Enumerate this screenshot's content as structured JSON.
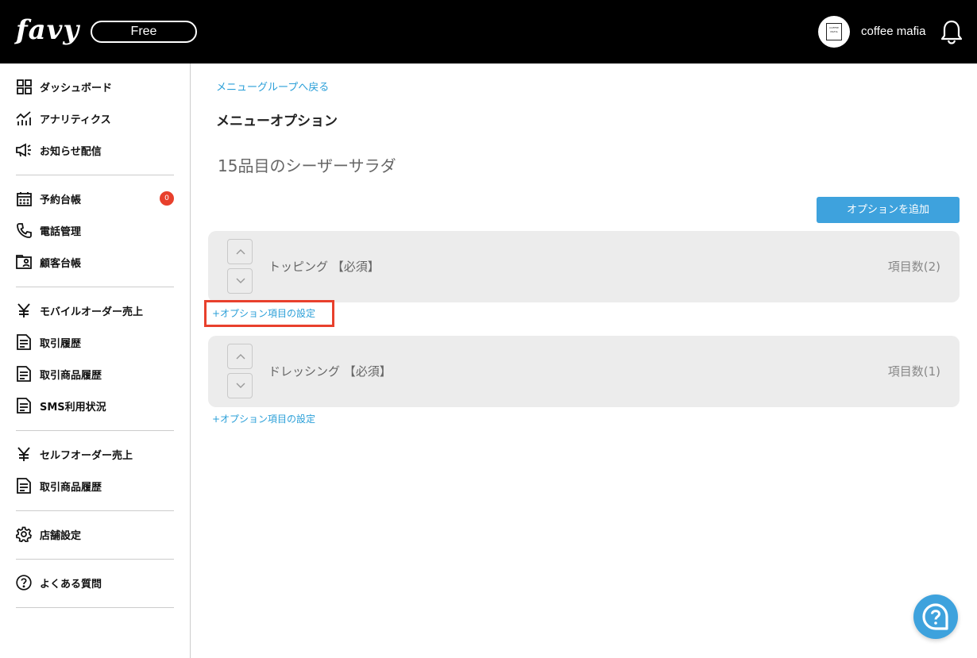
{
  "header": {
    "logo": "favy",
    "plan": "Free",
    "shop_name": "coffee mafia",
    "avatar_text": "COFFEE MAFIA"
  },
  "sidebar": {
    "items": [
      {
        "label": "ダッシュボード",
        "icon": "grid-icon"
      },
      {
        "label": "アナリティクス",
        "icon": "chart-icon"
      },
      {
        "label": "お知らせ配信",
        "icon": "megaphone-icon"
      },
      {
        "label": "予約台帳",
        "icon": "calendar-icon",
        "badge": "0"
      },
      {
        "label": "電話管理",
        "icon": "phone-icon"
      },
      {
        "label": "顧客台帳",
        "icon": "contact-card-icon"
      },
      {
        "label": "モバイルオーダー売上",
        "icon": "yen-icon"
      },
      {
        "label": "取引履歴",
        "icon": "document-icon"
      },
      {
        "label": "取引商品履歴",
        "icon": "document-icon"
      },
      {
        "label": "SMS利用状況",
        "icon": "document-icon"
      },
      {
        "label": "セルフオーダー売上",
        "icon": "yen-icon"
      },
      {
        "label": "取引商品履歴",
        "icon": "document-icon"
      },
      {
        "label": "店舗設定",
        "icon": "gear-icon"
      },
      {
        "label": "よくある質問",
        "icon": "question-circle-icon"
      }
    ]
  },
  "main": {
    "back_link": "メニューグループへ戻る",
    "page_title": "メニューオプション",
    "item_title": "15品目のシーザーサラダ",
    "add_button": "オプションを追加",
    "groups": [
      {
        "name": "トッピング 【必須】",
        "count": "項目数(2)",
        "setting_link": "+オプション項目の設定"
      },
      {
        "name": "ドレッシング 【必須】",
        "count": "項目数(1)",
        "setting_link": "+オプション項目の設定"
      }
    ]
  },
  "colors": {
    "accent": "#3ea2dd",
    "link": "#2a9fd8",
    "badge": "#e8402c",
    "highlight": "#e8402c",
    "header_bg": "#000000"
  }
}
